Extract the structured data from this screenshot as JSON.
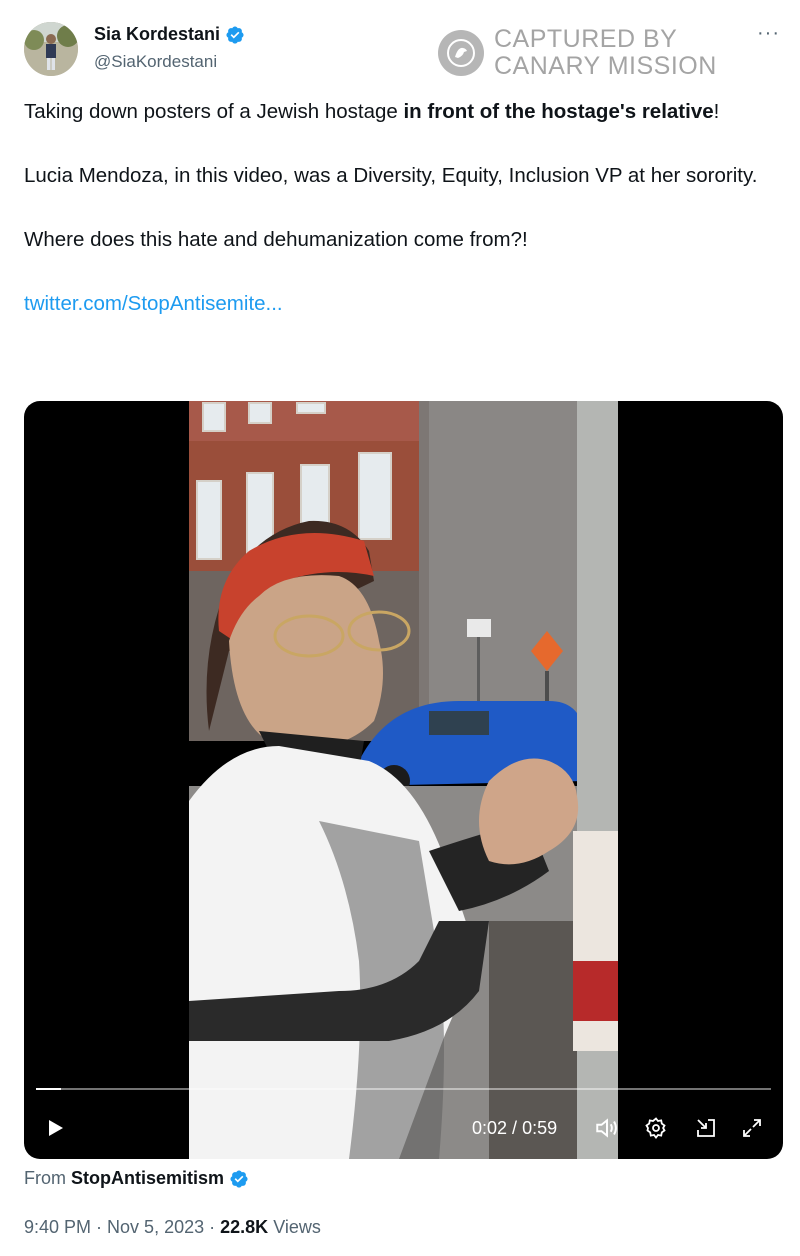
{
  "author": {
    "display_name": "Sia Kordestani",
    "handle": "@SiaKordestani",
    "verified": true
  },
  "more_icon": "more-dots-icon",
  "watermark": {
    "line1": "CAPTURED BY",
    "line2": "CANARY MISSION"
  },
  "tweet": {
    "line1_prefix": "Taking down posters of a Jewish hostage ",
    "line1_bold": "in front of the hostage's relative",
    "line1_suffix": "!",
    "paragraph2": "Lucia Mendoza, in this video, was a Diversity, Equity, Inclusion VP at her sorority.",
    "paragraph3": "Where does this hate and dehumanization come from?!",
    "link": "twitter.com/StopAntisemite..."
  },
  "video": {
    "current_time": "0:02",
    "separator": " / ",
    "duration": "0:59",
    "progress": 0.034,
    "controls": [
      "play-icon",
      "volume-icon",
      "settings-icon",
      "pip-icon",
      "fullscreen-icon"
    ]
  },
  "source": {
    "prefix": "From",
    "name": "StopAntisemitism",
    "verified": true
  },
  "meta": {
    "time": "9:40 PM",
    "dot1": "·",
    "date": "Nov 5, 2023",
    "dot2": "·",
    "views_count": "22.8K",
    "views_label": "Views"
  },
  "colors": {
    "link": "#1d9bf0",
    "verified": "#1d9bf0",
    "secondary_text": "#536471",
    "primary_text": "#0f1419"
  }
}
